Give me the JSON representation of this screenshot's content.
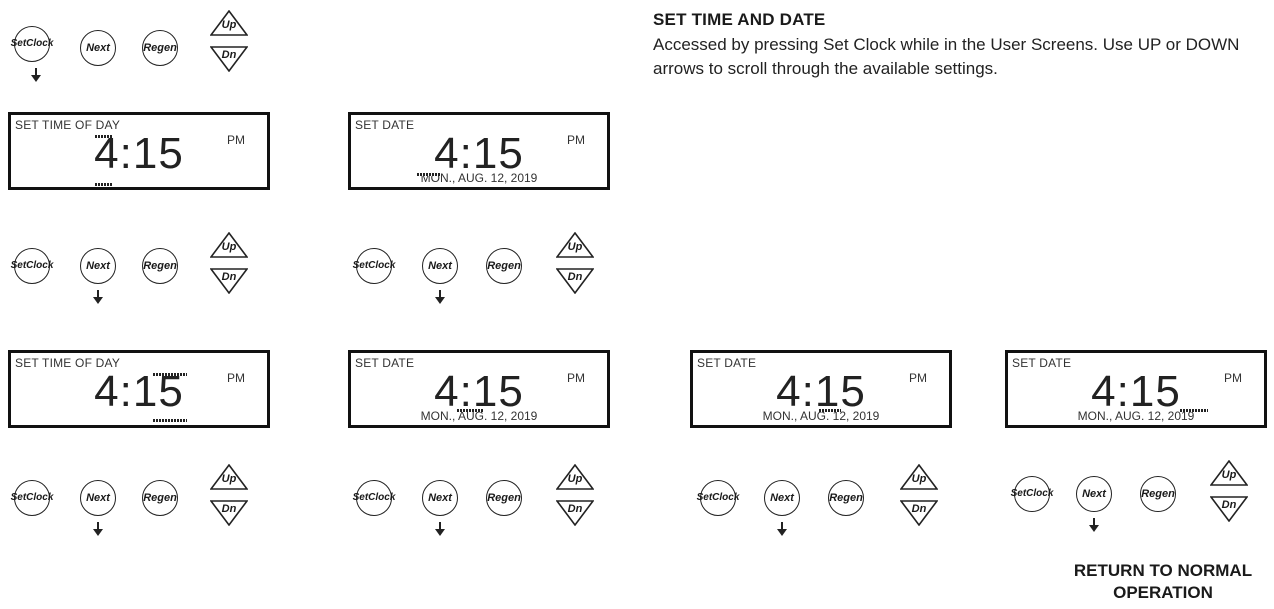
{
  "intro": {
    "heading": "SET TIME AND DATE",
    "description": "Accessed by pressing Set Clock while in the User Screens. Use UP or DOWN arrows to scroll through the available settings."
  },
  "buttons": {
    "set": "Set Clock",
    "next": "Next",
    "regen": "Regen",
    "up": "Up",
    "down": "Dn"
  },
  "displays": [
    {
      "label": "SET TIME OF DAY",
      "time": "4:15",
      "ampm": "PM",
      "date": "",
      "editing": "hour"
    },
    {
      "label": "SET DATE",
      "time": "4:15",
      "ampm": "PM",
      "date": "MON., AUG. 12, 2019",
      "editing": "day-of-week"
    },
    {
      "label": "SET TIME OF DAY",
      "time": "4:15",
      "ampm": "PM",
      "date": "",
      "editing": "minutes"
    },
    {
      "label": "SET DATE",
      "time": "4:15",
      "ampm": "PM",
      "date": "MON., AUG. 12, 2019",
      "editing": "month"
    },
    {
      "label": "SET DATE",
      "time": "4:15",
      "ampm": "PM",
      "date": "MON., AUG. 12, 2019",
      "editing": "day"
    },
    {
      "label": "SET DATE",
      "time": "4:15",
      "ampm": "PM",
      "date": "MON., AUG. 12, 2019",
      "editing": "year"
    }
  ],
  "final_note": "RETURN TO NORMAL OPERATION"
}
